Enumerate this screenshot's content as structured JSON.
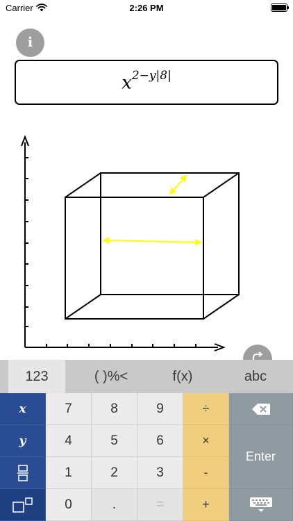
{
  "status": {
    "carrier": "Carrier",
    "time": "2:26 PM"
  },
  "info_button": {
    "label": "i",
    "icon": "info-icon"
  },
  "expression": {
    "base": "x",
    "exponent": "2−y|8|"
  },
  "redo_button": {
    "icon": "redo-icon"
  },
  "keyboard": {
    "tabs": [
      "123",
      "( )%<",
      "f(x)",
      "abc"
    ],
    "active_tab": "123",
    "keys": {
      "var_x": "x",
      "var_y": "y",
      "seven": "7",
      "eight": "8",
      "nine": "9",
      "four": "4",
      "five": "5",
      "six": "6",
      "one": "1",
      "two": "2",
      "three": "3",
      "zero": "0",
      "dot": ".",
      "equals": "=",
      "divide": "÷",
      "multiply": "×",
      "minus": "-",
      "plus": "+",
      "enter": "Enter"
    },
    "icons": [
      "fraction-icon",
      "superscript-icon",
      "backspace-icon",
      "keyboard-hide-icon"
    ]
  },
  "colors": {
    "variable_keys": "#294c93",
    "operator_keys": "#efcf7e",
    "function_keys": "#8f9aa1",
    "arrow_annotation": "#ffff00"
  }
}
